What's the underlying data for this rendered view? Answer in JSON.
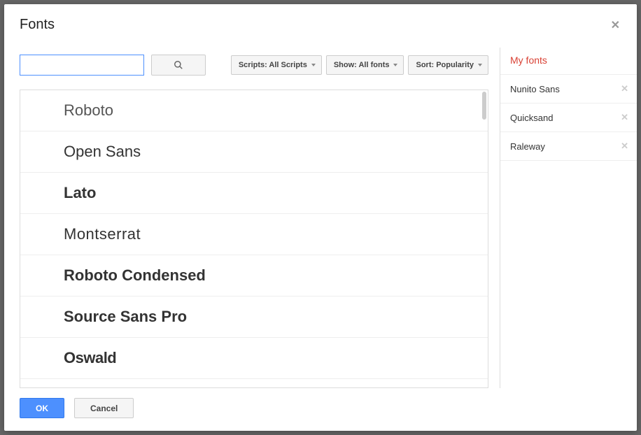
{
  "dialog": {
    "title": "Fonts"
  },
  "search": {
    "value": "",
    "placeholder": ""
  },
  "filters": {
    "scripts": "Scripts: All Scripts",
    "show": "Show: All fonts",
    "sort": "Sort: Popularity"
  },
  "fontList": [
    {
      "name": "Roboto",
      "class": "font-roboto"
    },
    {
      "name": "Open Sans",
      "class": "font-opensans"
    },
    {
      "name": "Lato",
      "class": "font-lato"
    },
    {
      "name": "Montserrat",
      "class": "font-montserrat"
    },
    {
      "name": "Roboto Condensed",
      "class": "font-robotocond"
    },
    {
      "name": "Source Sans Pro",
      "class": "font-sourcesans"
    },
    {
      "name": "Oswald",
      "class": "font-oswald"
    }
  ],
  "myFonts": {
    "title": "My fonts",
    "items": [
      "Nunito Sans",
      "Quicksand",
      "Raleway"
    ]
  },
  "buttons": {
    "ok": "OK",
    "cancel": "Cancel"
  }
}
